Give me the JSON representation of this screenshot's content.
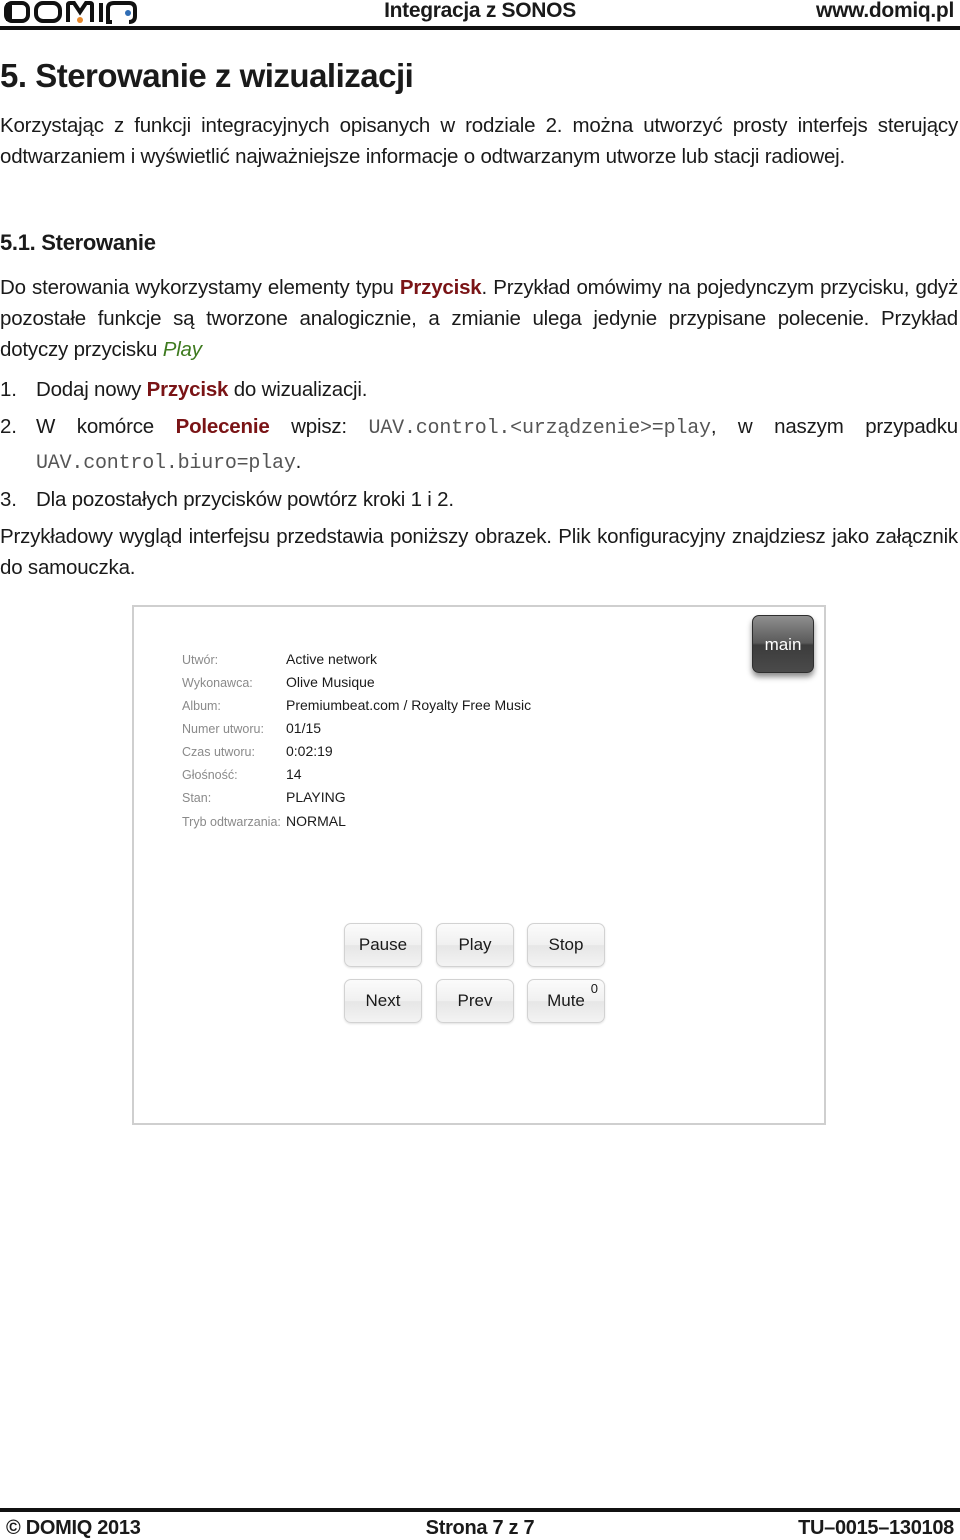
{
  "header": {
    "logo_text": "DOMIQ",
    "title": "Integracja z SONOS",
    "url": "www.domiq.pl"
  },
  "section": {
    "heading": "5. Sterowanie z wizualizacji",
    "intro": "Korzystając z funkcji integracyjnych opisanych w rodziale 2. można utworzyć prosty interfejs sterujący odtwarzaniem i wyświetlić najważniejsze informacje o odtwarzanym utworze lub stacji radiowej."
  },
  "subsection": {
    "heading": "5.1. Sterowanie",
    "para_part1": "Do sterowania wykorzystamy elementy typu ",
    "para_kw": "Przycisk",
    "para_part2": ". Przykład omówimy na pojedynczym przycisku, gdyż pozostałe funkcje są tworzone analogicznie, a zmianie ulega jedynie przypisane polecenie. Przykład dotyczy przycisku ",
    "para_play": "Play"
  },
  "steps": [
    {
      "num": "1.",
      "pre": "Dodaj nowy ",
      "kw": "Przycisk",
      "post": " do wizualizacji."
    },
    {
      "num": "2.",
      "pre": "W komórce ",
      "kw": "Polecenie",
      "mid": " wpisz: ",
      "code1": "UAV.control.<urządzenie>=play",
      "mid2": ", w naszym przypadku ",
      "code2": "UAV.control.biuro=play",
      "post": "."
    },
    {
      "num": "3.",
      "text": "Dla pozostałych przycisków powtórz kroki 1 i 2."
    }
  ],
  "closing": "Przykładowy wygląd interfejsu przedstawia poniższy obrazek. Plik konfiguracyjny znajdziesz jako załącznik do samouczka.",
  "visualization": {
    "main_button": "main",
    "info": [
      {
        "label": "Utwór:",
        "value": "Active network"
      },
      {
        "label": "Wykonawca:",
        "value": "Olive Musique"
      },
      {
        "label": "Album:",
        "value": "Premiumbeat.com / Royalty Free Music"
      },
      {
        "label": "Numer utworu:",
        "value": "01/15"
      },
      {
        "label": "Czas utworu:",
        "value": "0:02:19"
      },
      {
        "label": "Głośność:",
        "value": "14"
      },
      {
        "label": "Stan:",
        "value": "PLAYING"
      },
      {
        "label": "Tryb odtwarzania:",
        "value": "NORMAL"
      }
    ],
    "buttons": [
      {
        "label": "Pause"
      },
      {
        "label": "Play"
      },
      {
        "label": "Stop"
      },
      {
        "label": "Next"
      },
      {
        "label": "Prev"
      },
      {
        "label": "Mute",
        "badge": "0"
      }
    ]
  },
  "footer": {
    "copyright": "© DOMIQ 2013",
    "page": "Strona 7 z 7",
    "doc_id": "TU–0015–130108"
  },
  "colors": {
    "keyword": "#7a1416",
    "play_highlight": "#3e7a1f",
    "logo_orange": "#e8892b",
    "logo_blue": "#2f6db5"
  }
}
